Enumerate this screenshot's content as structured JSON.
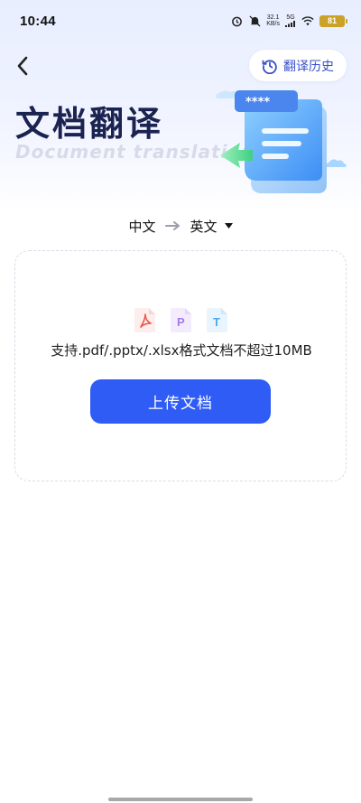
{
  "status_bar": {
    "time": "10:44",
    "net_speed_value": "32.1",
    "net_speed_unit": "KB/s",
    "signal_label": "5G",
    "battery": "81"
  },
  "header": {
    "history_label": "翻译历史"
  },
  "hero": {
    "title": "文档翻译",
    "subtitle": "Document translation",
    "illustration_mask": "****"
  },
  "language": {
    "source": "中文",
    "target": "英文"
  },
  "upload": {
    "file_types": [
      "pdf-file-icon",
      "ppt-file-icon",
      "txt-file-icon"
    ],
    "support_text": "支持.pdf/.pptx/.xlsx格式文档不超过10MB",
    "button_label": "上传文档"
  },
  "colors": {
    "accent": "#2f5cf5",
    "title": "#1b2350",
    "pdf": "#e8564a",
    "ppt": "#a878f0",
    "txt": "#4aa8f0"
  }
}
